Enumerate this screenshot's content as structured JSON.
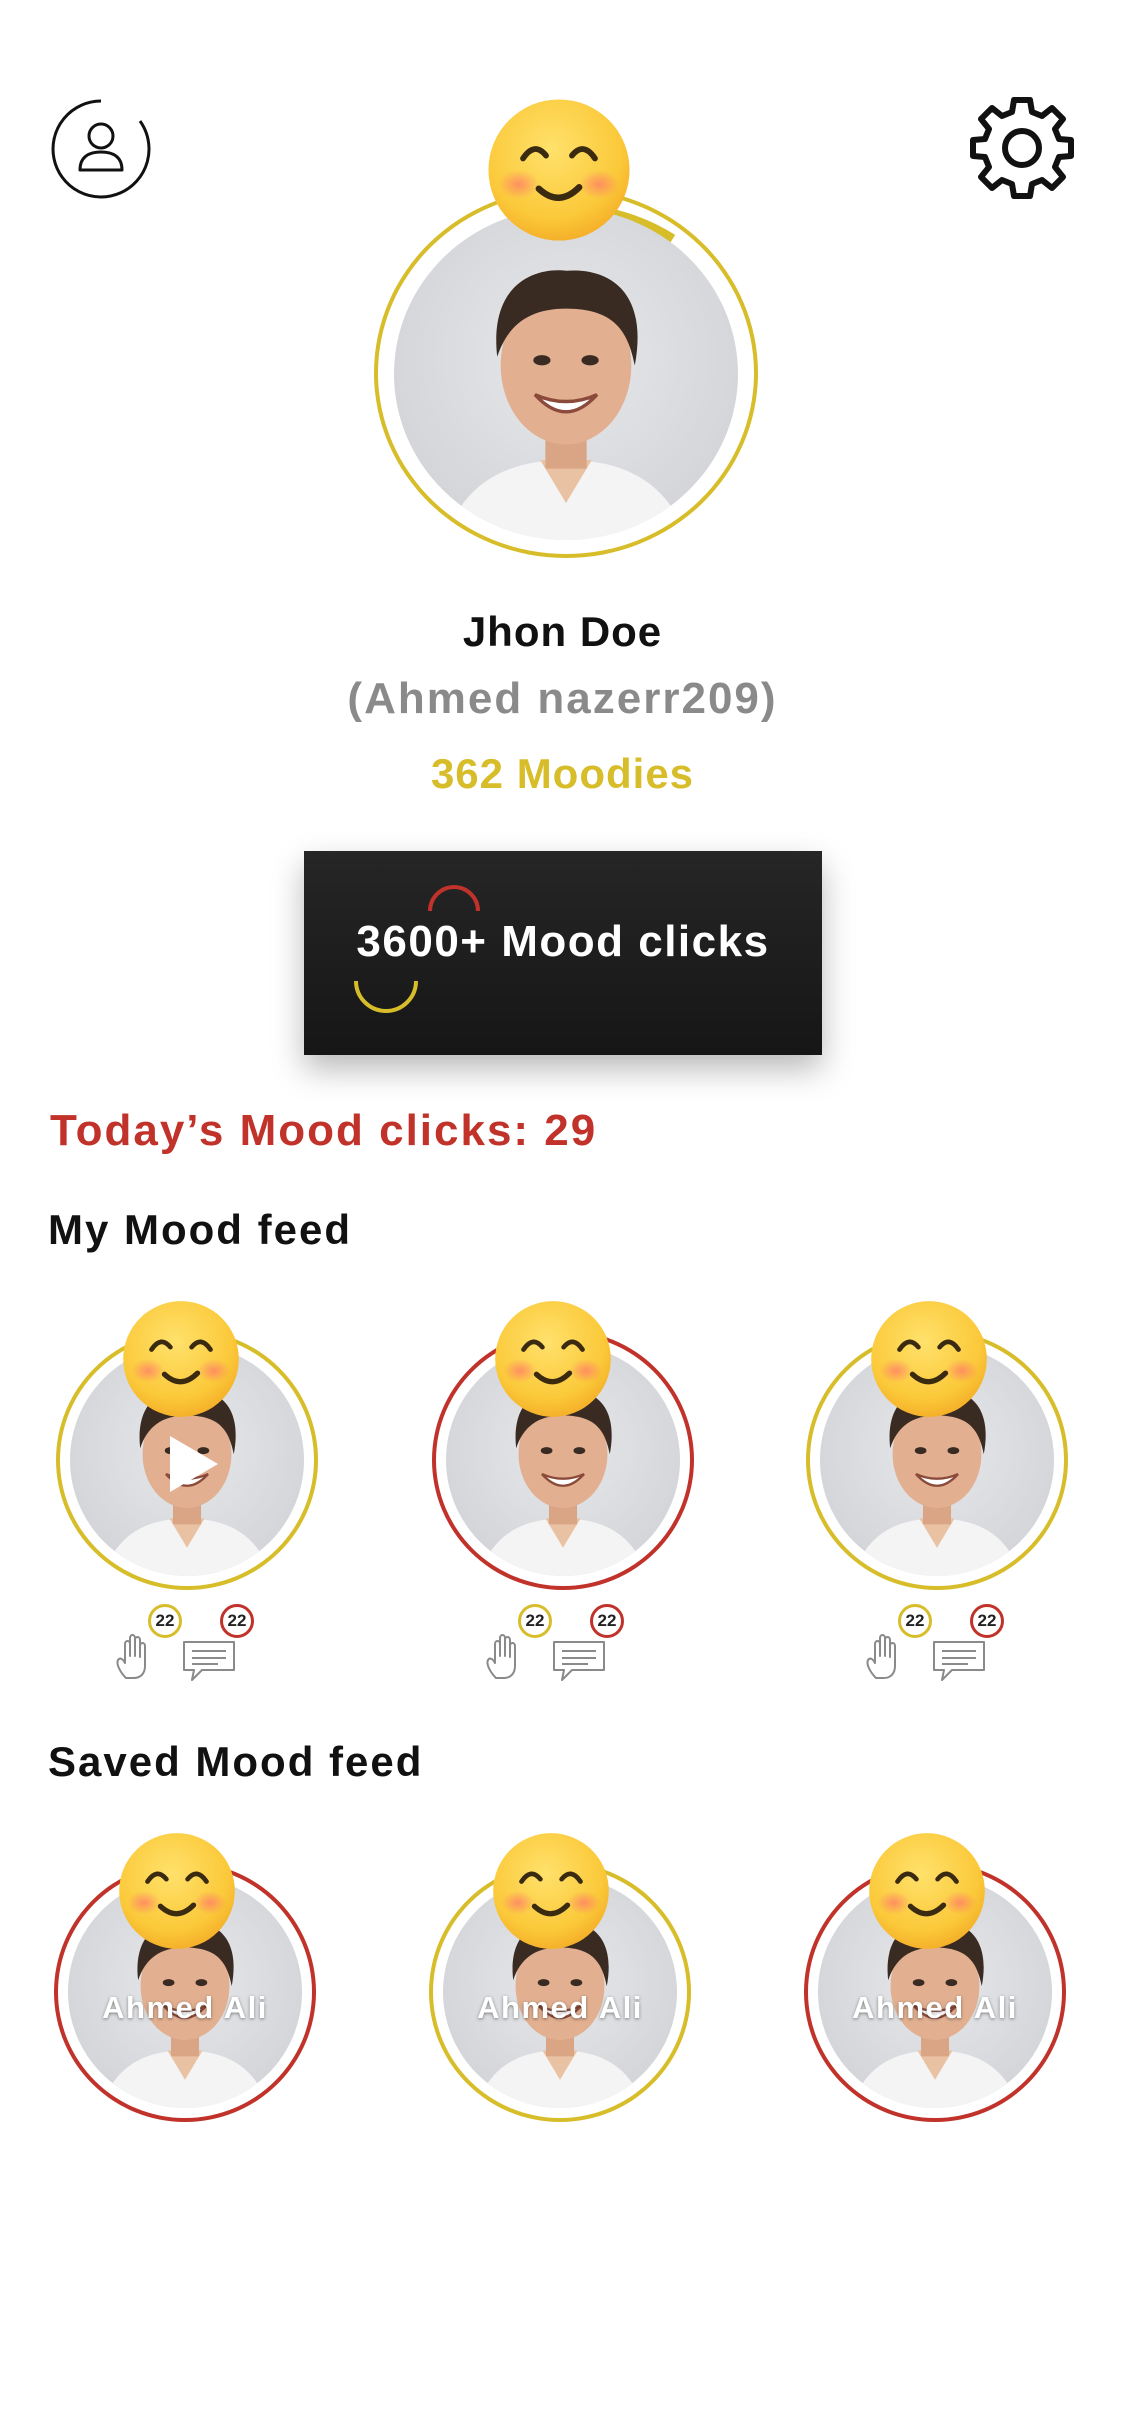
{
  "header": {
    "profile_icon": "user-profile-icon",
    "settings_icon": "gear-icon"
  },
  "profile": {
    "name": "Jhon Doe",
    "handle": "(Ahmed nazerr209)",
    "moodies": "362 Moodies",
    "ring_color": "#d8bd2a"
  },
  "mood_clicks": {
    "label": "3600+ Mood clicks"
  },
  "today": {
    "label": "Today’s Mood clicks: 29"
  },
  "my_feed": {
    "title": "My Mood feed",
    "items": [
      {
        "ring_color": "#d8bd2a",
        "likes": "22",
        "comments": "22",
        "has_play": true
      },
      {
        "ring_color": "#c0322a",
        "likes": "22",
        "comments": "22",
        "has_play": false
      },
      {
        "ring_color": "#d8bd2a",
        "likes": "22",
        "comments": "22",
        "has_play": false
      }
    ]
  },
  "saved_feed": {
    "title": "Saved Mood feed",
    "items": [
      {
        "ring_color": "#c0322a",
        "label": "Ahmed Ali"
      },
      {
        "ring_color": "#d8bd2a",
        "label": "Ahmed Ali"
      },
      {
        "ring_color": "#c0322a",
        "label": "Ahmed Ali"
      }
    ]
  },
  "colors": {
    "accent_yellow": "#d8bd2a",
    "accent_red": "#c0322a",
    "banner_dark": "#1c1c1c"
  }
}
